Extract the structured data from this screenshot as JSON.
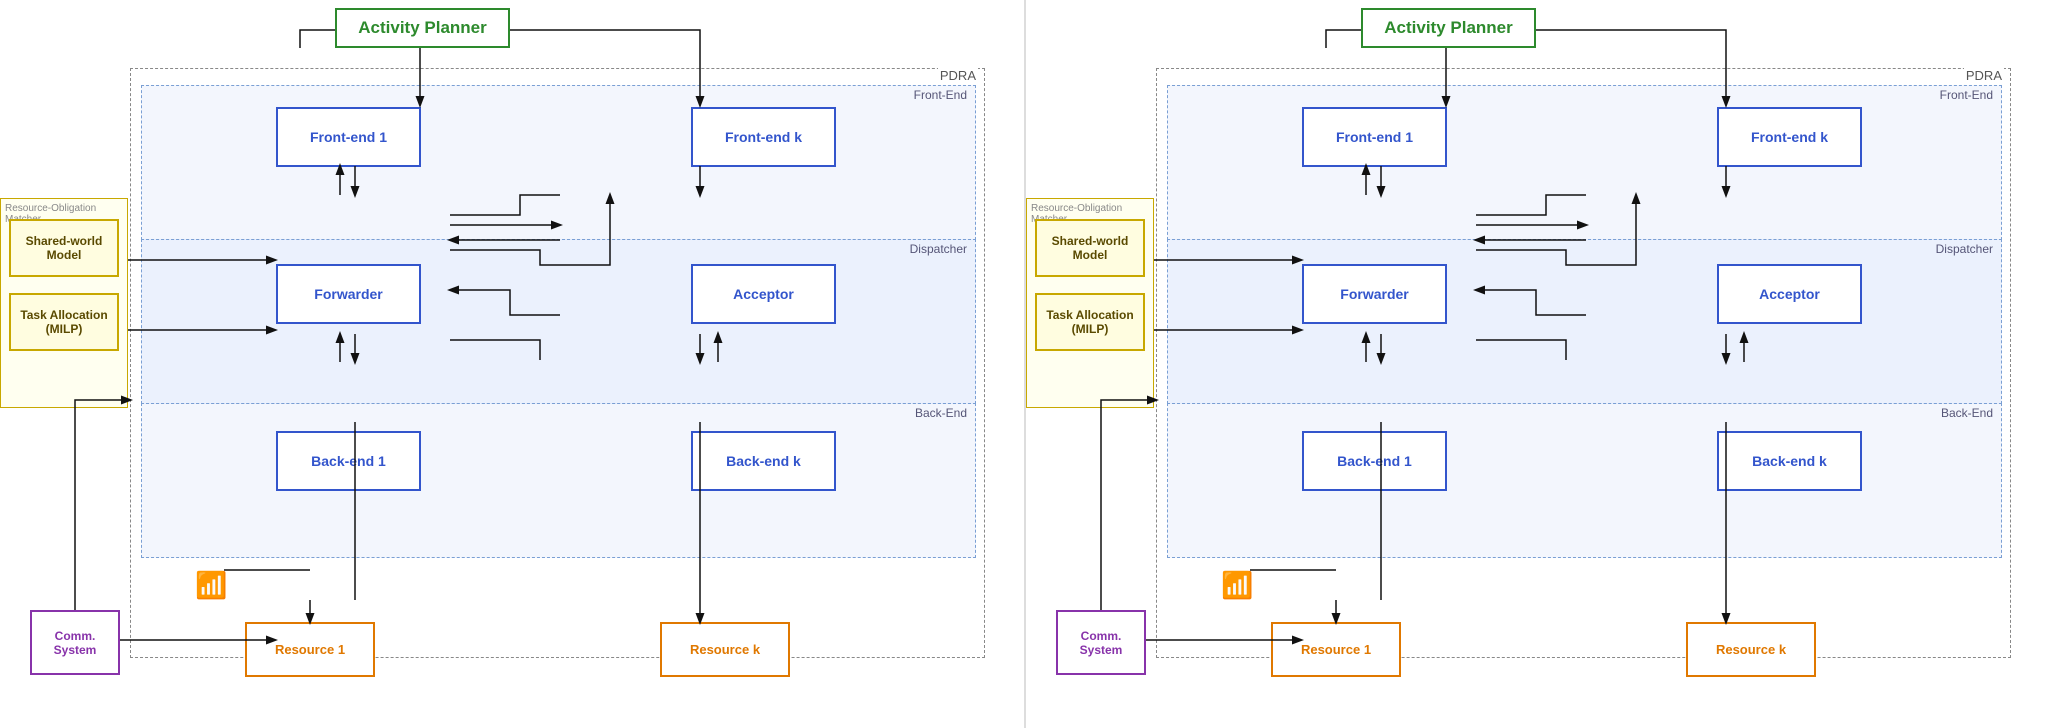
{
  "diagrams": [
    {
      "id": "left",
      "activity_planner": "Activity Planner",
      "pdra_label": "PDRA",
      "frontend_label": "Front-End",
      "dispatcher_label": "Dispatcher",
      "backend_label": "Back-End",
      "rom_label": "Resource-Obligation Matcher",
      "components": {
        "frontend1": "Front-end 1",
        "frontendk": "Front-end k",
        "forwarder": "Forwarder",
        "acceptor": "Acceptor",
        "backend1": "Back-end 1",
        "backendk": "Back-end k",
        "shared_world": "Shared-world\nModel",
        "task_allocation": "Task Allocation\n(MILP)",
        "comm_system": "Comm.\nSystem",
        "resource1": "Resource 1",
        "resourcek": "Resource k"
      }
    },
    {
      "id": "right",
      "activity_planner": "Activity Planner",
      "pdra_label": "PDRA",
      "frontend_label": "Front-End",
      "dispatcher_label": "Dispatcher",
      "backend_label": "Back-End",
      "rom_label": "Resource-Obligation Matcher",
      "components": {
        "frontend1": "Front-end 1",
        "frontendk": "Front-end k",
        "forwarder": "Forwarder",
        "acceptor": "Acceptor",
        "backend1": "Back-end 1",
        "backendk": "Back-end k",
        "shared_world": "Shared-world\nModel",
        "task_allocation": "Task Allocation\n(MILP)",
        "comm_system": "Comm.\nSystem",
        "resource1": "Resource 1",
        "resourcek": "Resource k"
      }
    }
  ],
  "colors": {
    "green_border": "#2d8a2d",
    "blue_border": "#3355cc",
    "yellow_border": "#c8a800",
    "purple_border": "#8833aa",
    "orange_border": "#e07800",
    "pdra_bg": "#e8edf8",
    "rom_bg": "#fffff0"
  }
}
